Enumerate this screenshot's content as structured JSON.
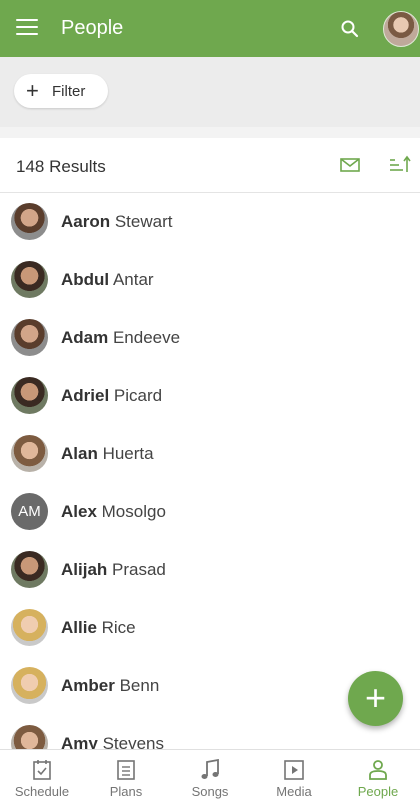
{
  "appbar": {
    "title": "People",
    "menu_icon": "hamburger-menu-icon",
    "search_icon": "search-icon",
    "avatar": "user-avatar"
  },
  "filter": {
    "label": "Filter",
    "icon": "plus-icon"
  },
  "results": {
    "count_label": "148 Results",
    "mail_icon": "mail-icon",
    "sort_icon": "sort-ascending-icon"
  },
  "people": [
    {
      "first": "Aaron",
      "last": " Stewart",
      "avatar": "photo"
    },
    {
      "first": "Abdul",
      "last": " Antar",
      "avatar": "photo"
    },
    {
      "first": "Adam",
      "last": " Endeeve",
      "avatar": "photo"
    },
    {
      "first": "Adriel",
      "last": " Picard",
      "avatar": "photo"
    },
    {
      "first": "Alan",
      "last": " Huerta",
      "avatar": "photo"
    },
    {
      "first": "Alex",
      "last": " Mosolgo",
      "avatar": "AM"
    },
    {
      "first": "Alijah",
      "last": " Prasad",
      "avatar": "photo"
    },
    {
      "first": "Allie",
      "last": " Rice",
      "avatar": "photo"
    },
    {
      "first": "Amber",
      "last": " Benn",
      "avatar": "photo"
    },
    {
      "first": "Amy",
      "last": " Stevens",
      "avatar": "photo"
    }
  ],
  "fab": {
    "icon": "plus-icon",
    "glyph": "+"
  },
  "bottom_nav": [
    {
      "label": "Schedule",
      "icon": "calendar-check-icon"
    },
    {
      "label": "Plans",
      "icon": "list-icon"
    },
    {
      "label": "Songs",
      "icon": "music-note-icon"
    },
    {
      "label": "Media",
      "icon": "play-icon"
    },
    {
      "label": "People",
      "icon": "person-icon",
      "active": true
    }
  ],
  "colors": {
    "accent": "#6fa84e",
    "text": "#333333",
    "muted": "#757575"
  }
}
